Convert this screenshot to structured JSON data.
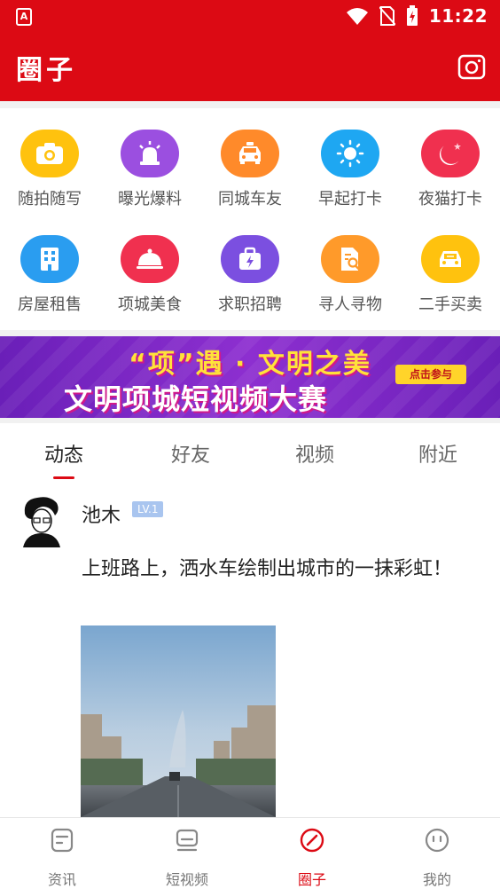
{
  "status_bar": {
    "time": "11:22",
    "app_badge": "A"
  },
  "header": {
    "title": "圈子"
  },
  "grid": {
    "items": [
      {
        "label": "随拍随写",
        "icon": "camera-icon",
        "color": "#ffc20e"
      },
      {
        "label": "曝光爆料",
        "icon": "siren-icon",
        "color": "#9b4fe0"
      },
      {
        "label": "同城车友",
        "icon": "taxi-icon",
        "color": "#ff8a2a"
      },
      {
        "label": "早起打卡",
        "icon": "sun-icon",
        "color": "#1ea7f2"
      },
      {
        "label": "夜猫打卡",
        "icon": "moon-icon",
        "color": "#f0304f"
      },
      {
        "label": "房屋租售",
        "icon": "building-icon",
        "color": "#2a9df0"
      },
      {
        "label": "项城美食",
        "icon": "food-cloche-icon",
        "color": "#f0304f"
      },
      {
        "label": "求职招聘",
        "icon": "briefcase-icon",
        "color": "#7b4fe0"
      },
      {
        "label": "寻人寻物",
        "icon": "search-document-icon",
        "color": "#ff9a2a"
      },
      {
        "label": "二手买卖",
        "icon": "car-icon",
        "color": "#ffc20e"
      }
    ]
  },
  "banner": {
    "line1": "“项”遇 · 文明之美",
    "line2": "文明项城短视频大赛",
    "cta": "点击参与"
  },
  "tabs": [
    {
      "label": "动态",
      "active": true
    },
    {
      "label": "好友",
      "active": false
    },
    {
      "label": "视频",
      "active": false
    },
    {
      "label": "附近",
      "active": false
    }
  ],
  "post": {
    "username": "池木",
    "level": "LV.1",
    "text": "上班路上，洒水车绘制出城市的一抹彩虹！"
  },
  "bottom_nav": [
    {
      "label": "资讯",
      "icon": "news-icon",
      "active": false
    },
    {
      "label": "短视频",
      "icon": "video-icon",
      "active": false
    },
    {
      "label": "圈子",
      "icon": "circle-pen-icon",
      "active": true
    },
    {
      "label": "我的",
      "icon": "profile-face-icon",
      "active": false
    }
  ],
  "colors": {
    "brand_red": "#dc0a14"
  }
}
